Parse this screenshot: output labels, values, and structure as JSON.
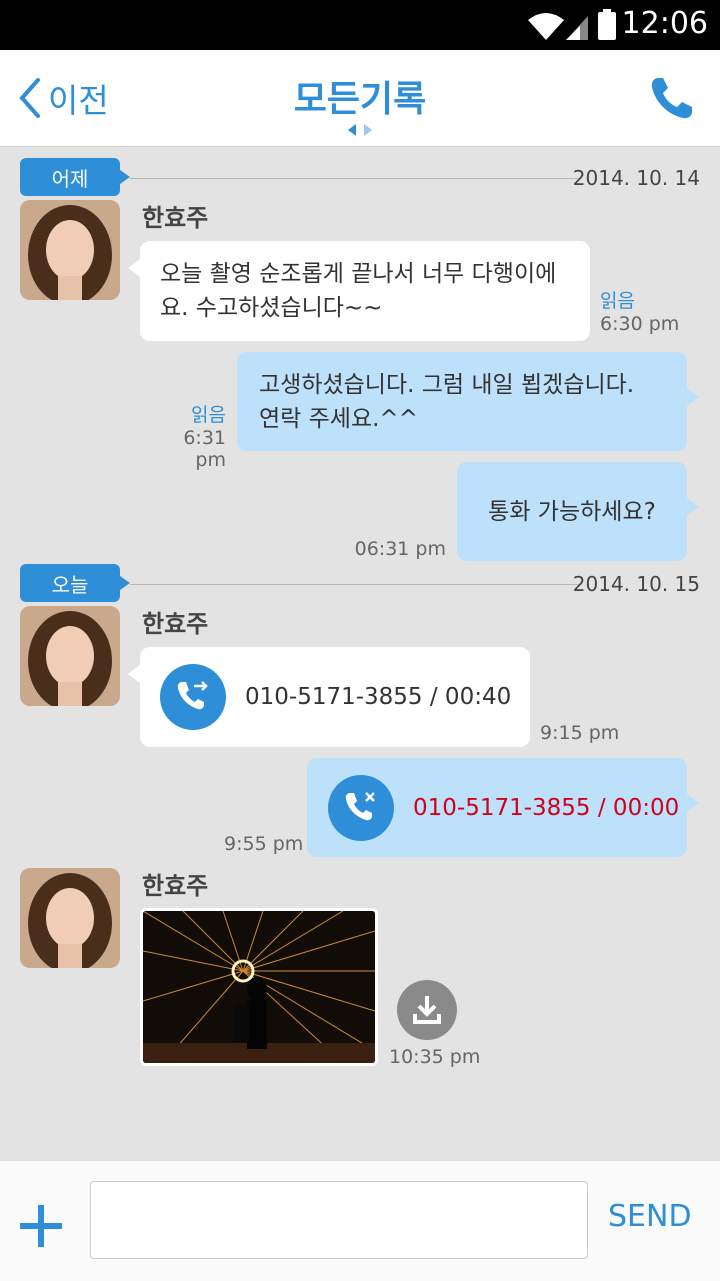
{
  "status": {
    "time": "12:06"
  },
  "header": {
    "back_label": "이전",
    "title": "모든기록"
  },
  "days": [
    {
      "badge": "어제",
      "date": "2014. 10. 14"
    },
    {
      "badge": "오늘",
      "date": "2014. 10. 15"
    }
  ],
  "messages": [
    {
      "sender": "한효주",
      "text_lines": [
        "오늘 촬영 순조롭게 끝나서 너무 다행이에",
        "요. 수고하셨습니다~~"
      ],
      "read": "읽음",
      "time": "6:30 pm"
    },
    {
      "text_lines": [
        "고생하셨습니다. 그럼 내일 뵙겠습니다.",
        "연락 주세요.^^"
      ],
      "read": "읽음",
      "time": "6:31 pm"
    },
    {
      "text": "통화 가능하세요?",
      "time": "06:31 pm"
    },
    {
      "sender": "한효주",
      "call": "010-5171-3855 / 00:40",
      "time": "9:15 pm"
    },
    {
      "call": "010-5171-3855 / 00:00",
      "time": "9:55 pm"
    },
    {
      "sender": "한효주",
      "time": "10:35 pm"
    }
  ],
  "composer": {
    "placeholder": "",
    "send_label": "SEND"
  },
  "colors": {
    "accent": "#2e8fd8",
    "outgoing_bubble": "#bde0fb",
    "missed_call_text": "#d0021b"
  },
  "icons": [
    "back-chevron-icon",
    "phone-icon",
    "incoming-call-icon",
    "missed-call-icon",
    "download-icon",
    "plus-icon"
  ]
}
